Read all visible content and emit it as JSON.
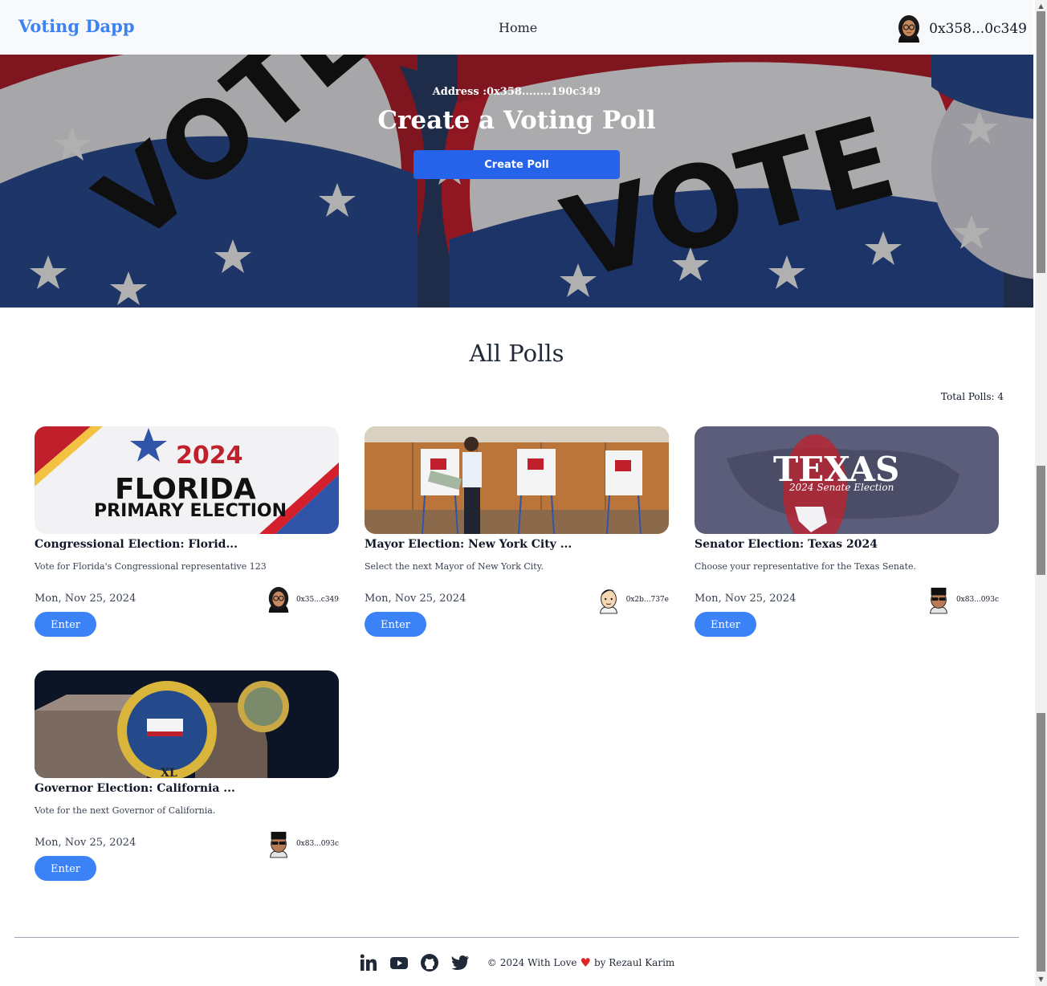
{
  "nav": {
    "brand": "Voting Dapp",
    "home": "Home",
    "wallet_address": "0x358...0c349"
  },
  "hero": {
    "address": "Address :0x358........190c349",
    "title": "Create a Voting Poll",
    "create_button": "Create Poll"
  },
  "polls": {
    "heading": "All Polls",
    "total": "Total Polls: 4",
    "items": [
      {
        "title": "Congressional Election: Florid...",
        "description": "Vote for Florida's Congressional representative 123",
        "date": "Mon, Nov 25, 2024",
        "owner": "0x35...c349",
        "enter": "Enter",
        "image_text_1": "2024",
        "image_text_2": "FLORIDA",
        "image_text_3": "PRIMARY ELECTION"
      },
      {
        "title": "Mayor Election: New York City ...",
        "description": "Select the next Mayor of New York City.",
        "date": "Mon, Nov 25, 2024",
        "owner": "0x2b...737e",
        "enter": "Enter"
      },
      {
        "title": "Senator Election: Texas 2024",
        "description": "Choose your representative for the Texas Senate.",
        "date": "Mon, Nov 25, 2024",
        "owner": "0x83...093c",
        "enter": "Enter",
        "image_text_1": "TEXAS",
        "image_text_2": "2024 Senate Election"
      },
      {
        "title": "Governor Election: California ...",
        "description": "Vote for the next Governor of California.",
        "date": "Mon, Nov 25, 2024",
        "owner": "0x83...093c",
        "enter": "Enter"
      }
    ]
  },
  "footer": {
    "copyright": "2024 With Love",
    "author": "by Rezaul Karim",
    "icons": [
      "linkedin-icon",
      "youtube-icon",
      "github-icon",
      "twitter-icon"
    ]
  },
  "colors": {
    "brand": "#3b82f6",
    "primary_button": "#2563eb",
    "enter_button": "#3b82f6",
    "heart": "#dc2626"
  }
}
